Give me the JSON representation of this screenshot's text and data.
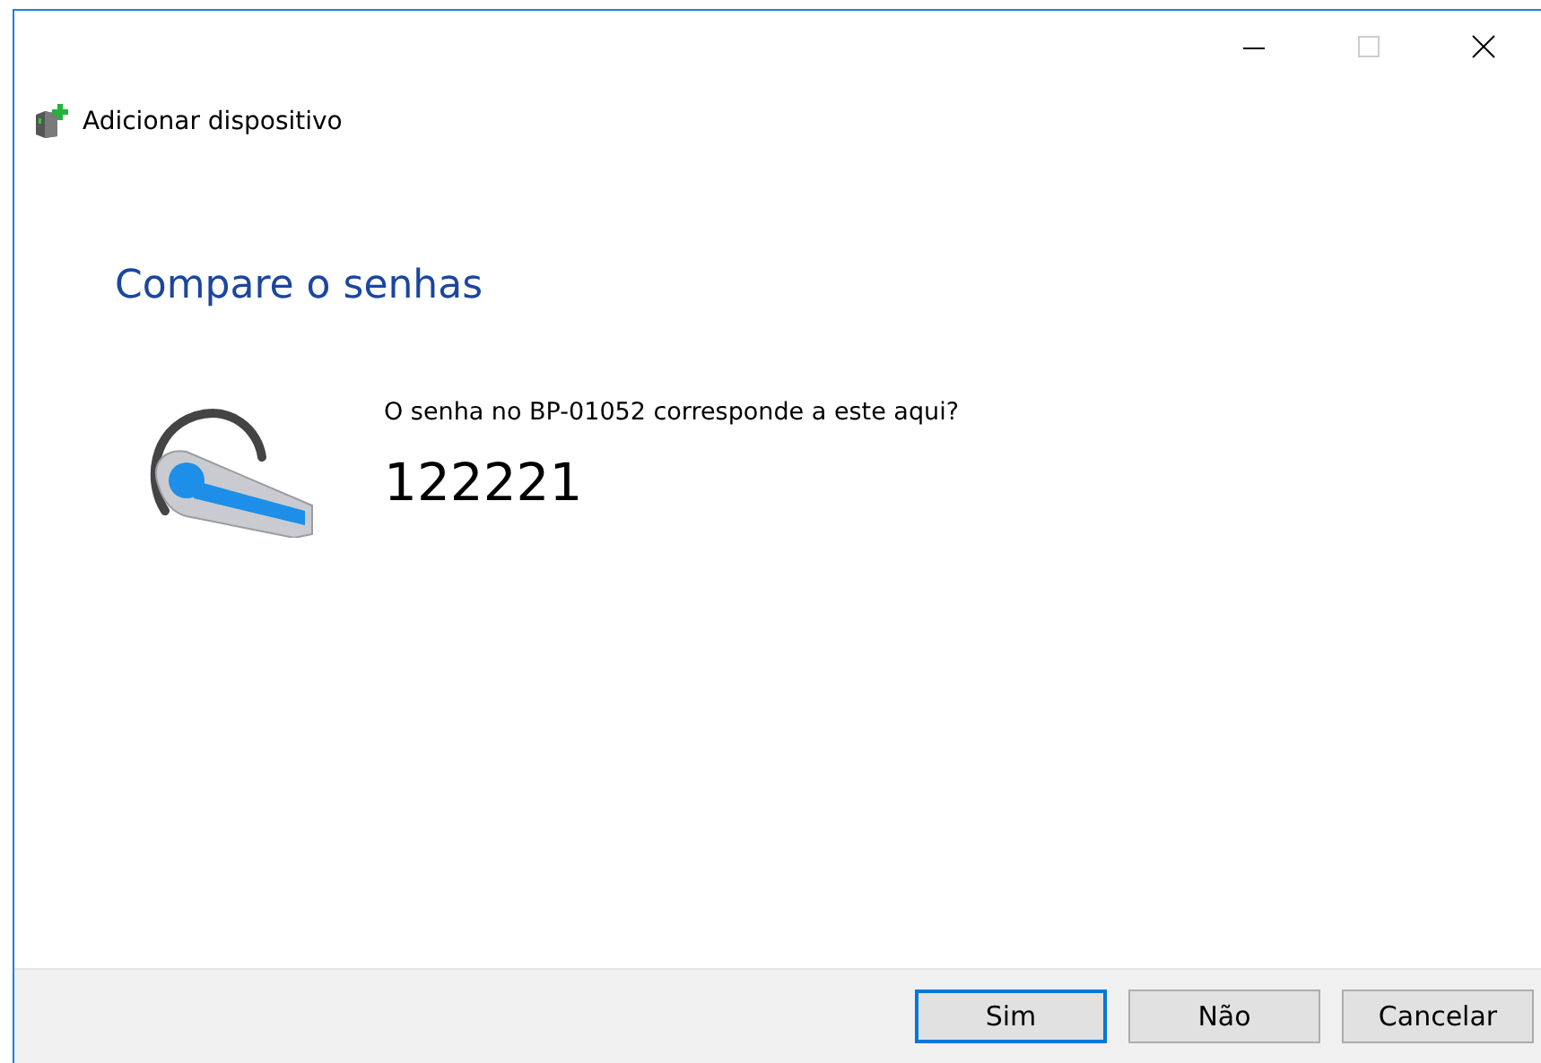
{
  "window": {
    "title": "Adicionar dispositivo"
  },
  "heading": "Compare o senhas",
  "question": "O senha no BP-01052 corresponde a este aqui?",
  "code": "122221",
  "buttons": [
    {
      "label": "Sim",
      "default": true
    },
    {
      "label": "Não",
      "default": false
    },
    {
      "label": "Cancelar",
      "default": false
    }
  ]
}
